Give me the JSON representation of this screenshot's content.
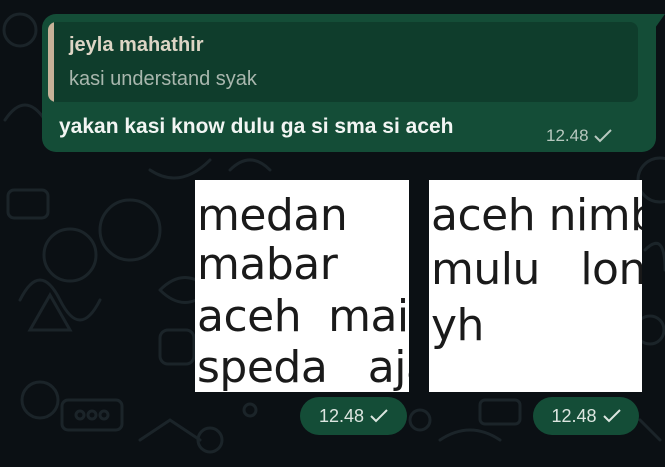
{
  "message": {
    "reply_author": "jeyla mahathir",
    "reply_text": "kasi understand syak",
    "text": "yakan kasi know dulu ga si sma si aceh",
    "time": "12.48"
  },
  "images": [
    {
      "lines": [
        "medan",
        "mabar",
        "aceh  main",
        "speda   aja"
      ],
      "time": "12.48"
    },
    {
      "lines": [
        "aceh nimb",
        "mulu   lonli",
        "yh"
      ],
      "time": "12.48"
    }
  ],
  "icons": {
    "tick": "single-check-icon"
  },
  "colors": {
    "bubble": "#144d37",
    "background": "#0b1014",
    "reply_bar": "#c7b299"
  }
}
